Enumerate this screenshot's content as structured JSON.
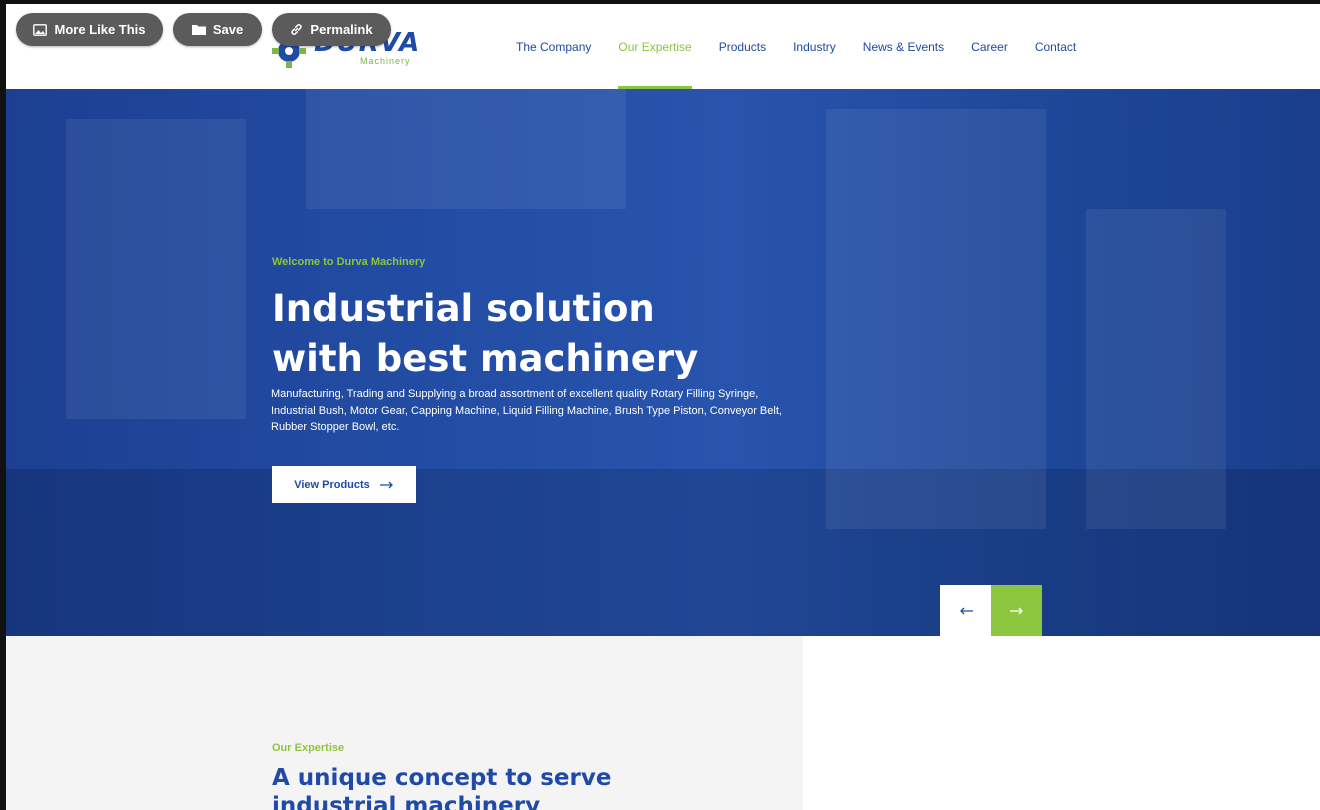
{
  "toolbar": {
    "more_like_this": "More Like This",
    "save": "Save",
    "permalink": "Permalink"
  },
  "logo": {
    "word": "DURVA",
    "sub": "Machinery"
  },
  "nav": {
    "items": [
      {
        "label": "The Company"
      },
      {
        "label": "Our Expertise",
        "active": true
      },
      {
        "label": "Products"
      },
      {
        "label": "Industry"
      },
      {
        "label": "News & Events"
      },
      {
        "label": "Career"
      },
      {
        "label": "Contact"
      }
    ]
  },
  "hero": {
    "eyebrow": "Welcome to Durva Machinery",
    "headline_line1": "Industrial solution",
    "headline_line2": "with best machinery",
    "description": "Manufacturing, Trading and Supplying a broad assortment of excellent quality Rotary Filling Syringe, Industrial Bush, Motor Gear, Capping Machine, Liquid Filling Machine, Brush Type Piston, Conveyor Belt, Rubber Stopper Bowl, etc.",
    "cta": "View Products",
    "cta_icon": "arrow-right-icon",
    "prev_icon": "arrow-left-icon",
    "next_icon": "arrow-right-icon"
  },
  "expertise": {
    "eyebrow": "Our Expertise",
    "title": "A unique concept to serve industrial machinery"
  },
  "colors": {
    "brand_blue": "#1f4aa8",
    "accent_green": "#8cc63f",
    "overlay_gray": "#5b5b5b"
  }
}
